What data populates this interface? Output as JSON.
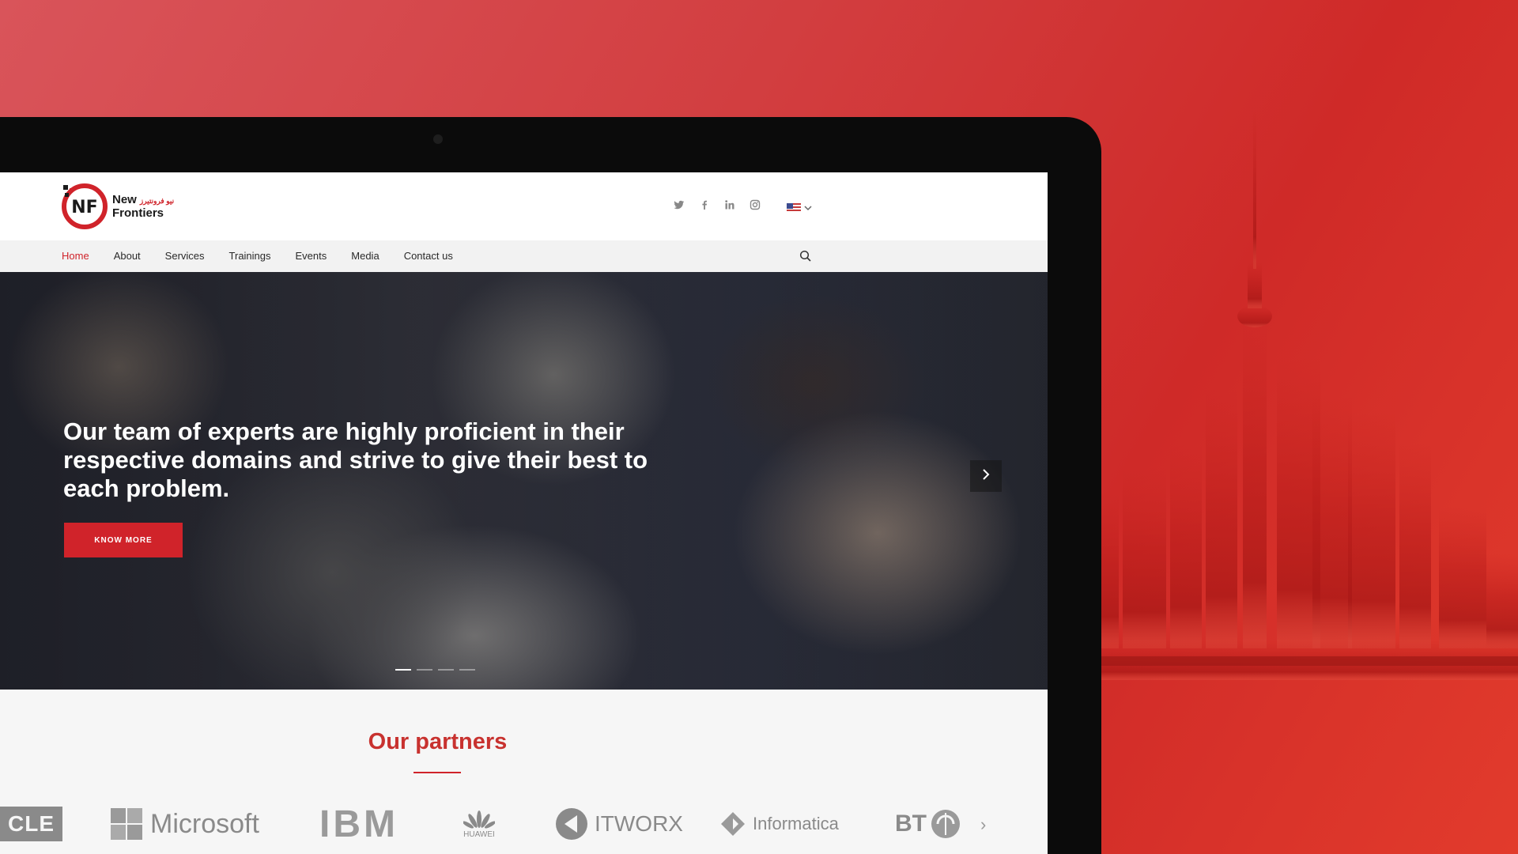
{
  "brand": {
    "name_line1": "New",
    "name_line2": "Frontiers",
    "name_arabic": "نيو فرونتيرز",
    "logo_initials": "NF",
    "accent": "#d0232a"
  },
  "social": [
    "twitter-icon",
    "facebook-icon",
    "linkedin-icon",
    "instagram-icon"
  ],
  "language": {
    "selected": "en-US"
  },
  "nav": {
    "items": [
      {
        "label": "Home",
        "active": true
      },
      {
        "label": "About"
      },
      {
        "label": "Services"
      },
      {
        "label": "Trainings"
      },
      {
        "label": "Events"
      },
      {
        "label": "Media"
      },
      {
        "label": "Contact us"
      }
    ]
  },
  "hero": {
    "headline": "Our team of experts are highly proficient in their respective domains and strive to give their best to each problem.",
    "cta_label": "KNOW MORE",
    "slides": 4,
    "active_slide": 1
  },
  "partners": {
    "title": "Our partners",
    "logos": [
      {
        "name": "CLE",
        "text": "CLE"
      },
      {
        "name": "Microsoft",
        "text": "Microsoft"
      },
      {
        "name": "IBM",
        "text": "IBM"
      },
      {
        "name": "Huawei",
        "text": "HUAWEI"
      },
      {
        "name": "ITWORX",
        "text": "ITWORX"
      },
      {
        "name": "Informatica",
        "text": "Informatica"
      },
      {
        "name": "BT",
        "text": "BT"
      }
    ]
  }
}
